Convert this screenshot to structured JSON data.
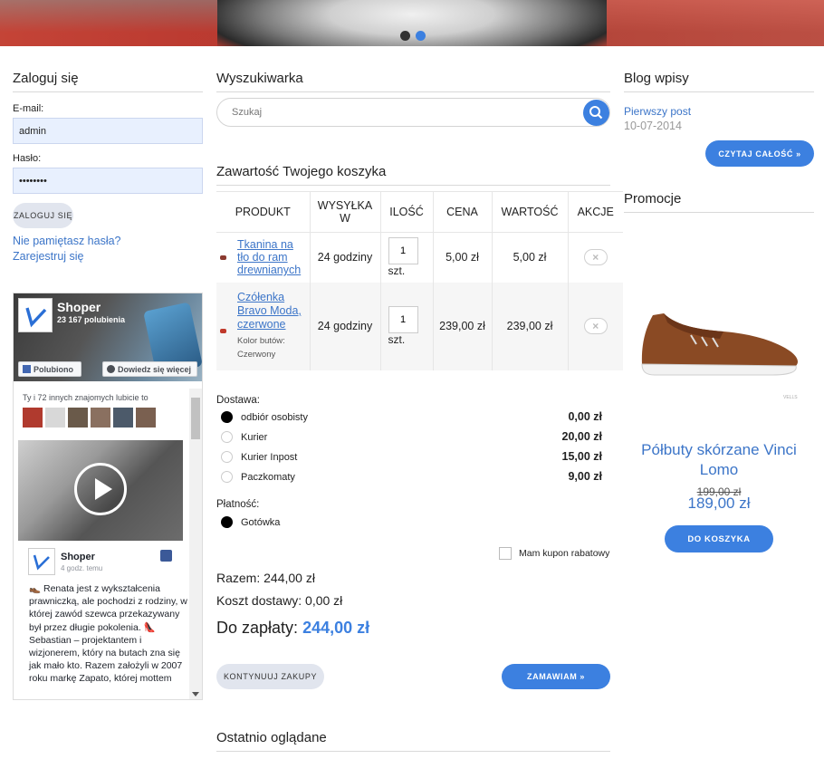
{
  "colors": {
    "accent": "#3c80e0",
    "link": "#3c75c8",
    "total": "#3c80e0"
  },
  "login": {
    "title": "Zaloguj się",
    "email_label": "E-mail:",
    "email_value": "admin",
    "password_label": "Hasło:",
    "password_value": "••••••••",
    "submit_label": "ZALOGUJ SIĘ",
    "forgot_link": "Nie pamiętasz hasła?",
    "register_link": "Zarejestruj się"
  },
  "facebook": {
    "page_name": "Shoper",
    "likes": "23 167 polubienia",
    "like_button": "Polubiono",
    "more_button": "Dowiedz się więcej",
    "friends_text": "Ty i 72 innych znajomych lubicie to",
    "post_author": "Shoper",
    "post_time": "4 godz. temu",
    "post_text": "👞 Renata jest z wykształcenia prawniczką, ale pochodzi z rodziny, w której zawód szewca przekazywany był przez długie pokolenia. 👠 Sebastian – projektantem i wizjonerem, który na butach zna się jak mało kto. Razem założyli w 2007 roku markę Zapato, której mottem"
  },
  "search": {
    "title": "Wyszukiwarka",
    "placeholder": "Szukaj"
  },
  "cart": {
    "title": "Zawartość Twojego koszyka",
    "headers": [
      "PRODUKT",
      "WYSYŁKA W",
      "ILOŚĆ",
      "CENA",
      "WARTOŚĆ",
      "AKCJE"
    ],
    "rows": [
      {
        "name": "Tkanina na tło do ram drewnianych",
        "variant_label": "",
        "variant_value": "",
        "shipping": "24 godziny",
        "qty": "1",
        "unit": "szt.",
        "price": "5,00 zł",
        "value": "5,00 zł"
      },
      {
        "name": "Czółenka Bravo Moda, czerwone",
        "variant_label": "Kolor butów:",
        "variant_value": "Czerwony",
        "shipping": "24 godziny",
        "qty": "1",
        "unit": "szt.",
        "price": "239,00 zł",
        "value": "239,00 zł"
      }
    ],
    "delivery_label": "Dostawa:",
    "delivery_options": [
      {
        "label": "odbiór osobisty",
        "price": "0,00 zł"
      },
      {
        "label": "Kurier",
        "price": "20,00 zł"
      },
      {
        "label": "Kurier Inpost",
        "price": "15,00 zł"
      },
      {
        "label": "Paczkomaty",
        "price": "9,00 zł"
      }
    ],
    "payment_label": "Płatność:",
    "payment_option": "Gotówka",
    "coupon_label": "Mam kupon rabatowy",
    "sum_text": "Razem: 244,00 zł",
    "shipping_cost_text": "Koszt dostawy: 0,00 zł",
    "to_pay_label": "Do zapłaty:",
    "to_pay_value": "244,00 zł",
    "continue_button": "KONTYNUUJ ZAKUPY",
    "order_button": "ZAMAWIAM »"
  },
  "recent": {
    "title": "Ostatnio oglądane"
  },
  "blog": {
    "title": "Blog wpisy",
    "post_title": "Pierwszy post",
    "post_date": "10-07-2014",
    "read_more": "CZYTAJ CAŁOŚĆ »"
  },
  "promo": {
    "title": "Promocje",
    "product_name": "Półbuty skórzane Vinci Lomo",
    "old_price": "199,00 zł",
    "new_price": "189,00 zł",
    "button": "DO KOSZYKA",
    "image_caption": "VELLS"
  }
}
